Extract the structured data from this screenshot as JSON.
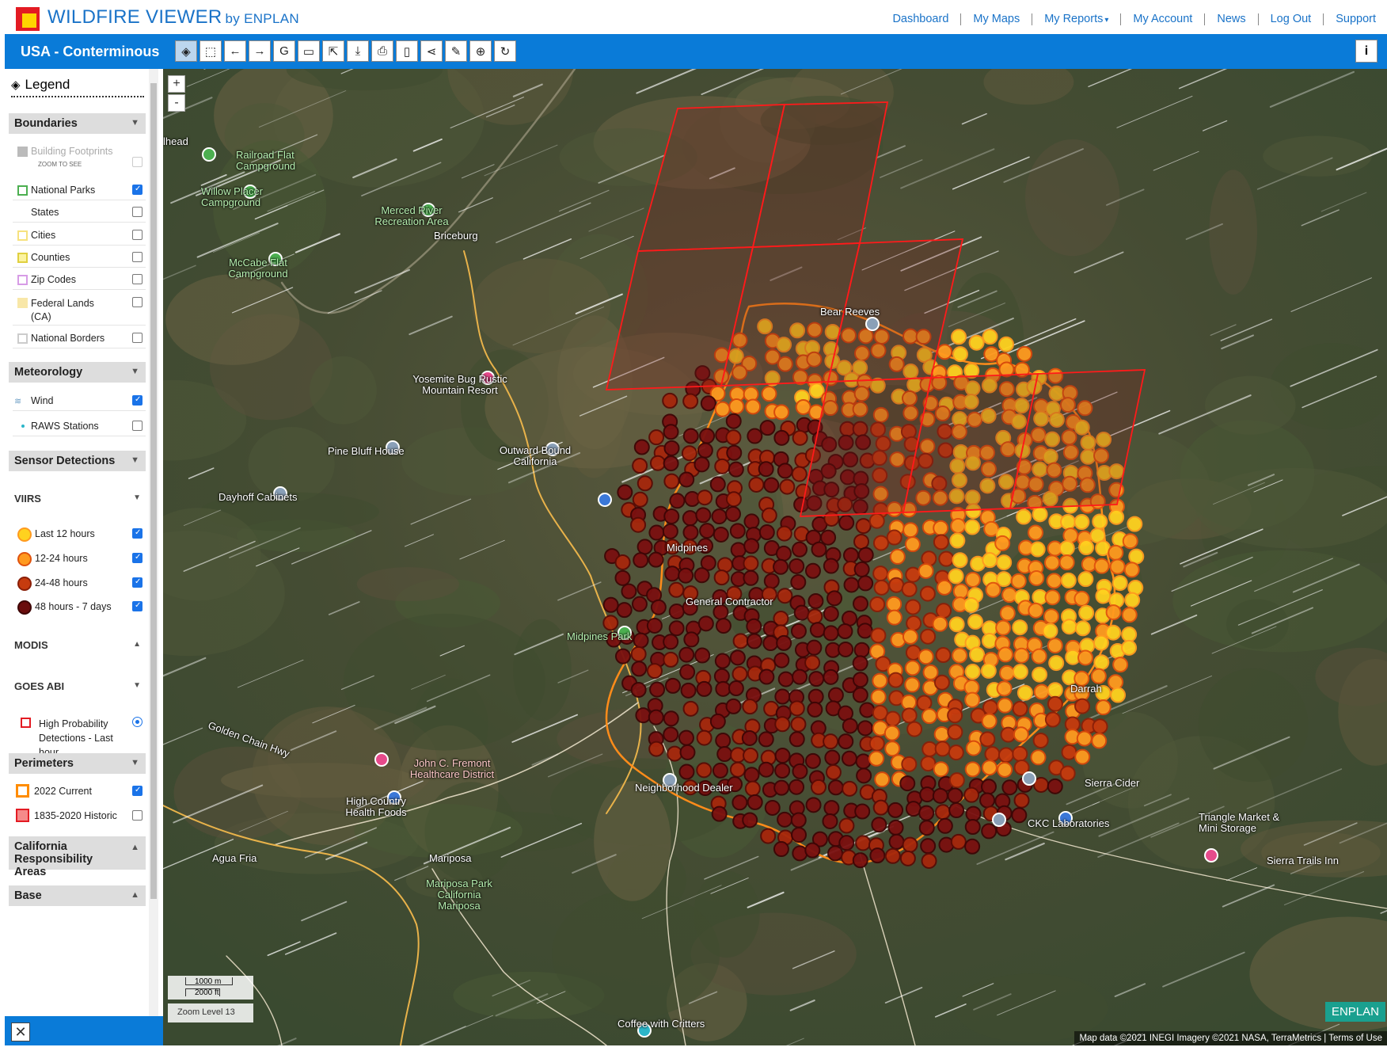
{
  "header": {
    "brand": "WILDFIRE VIEWER",
    "brand_by": "by ENPLAN",
    "nav": [
      "Dashboard",
      "My Maps",
      "My Reports",
      "My Account",
      "News",
      "Log Out",
      "Support"
    ]
  },
  "toolbar": {
    "region": "USA - Conterminous",
    "tools": [
      "layers-icon",
      "select-box-icon",
      "back-arrow-icon",
      "forward-arrow-icon",
      "google-icon",
      "ruler-icon",
      "identify-icon",
      "download-icon",
      "print-icon",
      "bookmark-icon",
      "share-icon",
      "edit-icon",
      "locate-icon",
      "refresh-icon"
    ],
    "info": "i"
  },
  "legend": {
    "title": "Legend",
    "boundaries": {
      "label": "Boundaries",
      "building_footprints": "Building Footprints",
      "zoom_to_see": "ZOOM TO SEE",
      "items": [
        {
          "label": "National Parks",
          "checked": true,
          "color": "#4caf50"
        },
        {
          "label": "States",
          "checked": false,
          "color": ""
        },
        {
          "label": "Cities",
          "checked": false,
          "color": "#f6e27f"
        },
        {
          "label": "Counties",
          "checked": false,
          "color": "#e0d040"
        },
        {
          "label": "Zip Codes",
          "checked": false,
          "color": "#d79ce6"
        },
        {
          "label": "Federal Lands (CA)",
          "checked": false,
          "color": "#f8e7a8"
        },
        {
          "label": "National Borders",
          "checked": false,
          "color": "#cccccc"
        }
      ]
    },
    "meteorology": {
      "label": "Meteorology",
      "items": [
        {
          "label": "Wind",
          "checked": true
        },
        {
          "label": "RAWS Stations",
          "checked": false
        }
      ]
    },
    "sensor": {
      "label": "Sensor Detections",
      "viirs": "VIIRS",
      "viirs_items": [
        {
          "label": "Last 12 hours",
          "checked": true,
          "color": "#ffd21f"
        },
        {
          "label": "12-24 hours",
          "checked": true,
          "color": "#ff9a1f"
        },
        {
          "label": "24-48 hours",
          "checked": true,
          "color": "#c63b0e"
        },
        {
          "label": "48 hours - 7 days",
          "checked": true,
          "color": "#6a0d0d"
        }
      ],
      "modis": "MODIS",
      "goes": "GOES ABI",
      "goes_item": "High Probability Detections - Last hour"
    },
    "perimeters": {
      "label": "Perimeters",
      "items": [
        {
          "label": "2022 Current",
          "checked": true
        },
        {
          "label": "1835-2020 Historic",
          "checked": false
        }
      ]
    },
    "california": "California Responsibility Areas",
    "base": "Base"
  },
  "map": {
    "zoom_in": "+",
    "zoom_out": "-",
    "scale_m": "1000 m",
    "scale_ft": "2000 ft",
    "zoom_level": "Zoom Level  13",
    "attribution": "Map data ©2021 INEGI Imagery ©2021 NASA, TerraMetrics | Terms of Use",
    "badge": "ENPLAN",
    "places": [
      "Railroad Flat Campground",
      "Willow Placer Campground",
      "Merced River Recreation Area",
      "Briceburg",
      "McCabe Flat Campground",
      "Yosemite Bug Rustic Mountain Resort",
      "Pine Bluff House",
      "Outward Bound California",
      "Dayhoff Cabinets",
      "Midpines Park",
      "John C. Fremont Healthcare District",
      "High Country Health Foods",
      "Mariposa",
      "Mariposa Park California Mariposa",
      "Agua Fria",
      "Coffee with Critters",
      "Sierra Cider",
      "CKC Laboratories",
      "Triangle Market & Mini Storage",
      "Sierra Trails Inn",
      "Neighborhood Dealer",
      "Golden Chain Hwy",
      "Bear Reeves",
      "Midpines",
      "General Contractor",
      "Darrah",
      "lhead"
    ]
  }
}
